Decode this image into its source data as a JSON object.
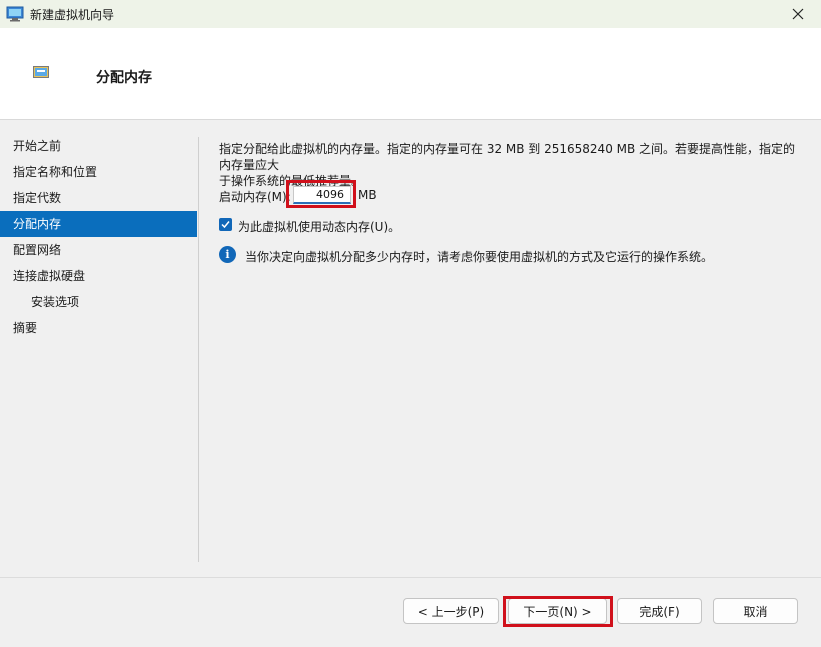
{
  "window": {
    "title": "新建虚拟机向导",
    "close_icon": "close-icon"
  },
  "header": {
    "title": "分配内存",
    "icon": "memory-chip-icon"
  },
  "nav": {
    "items": [
      {
        "label": "开始之前",
        "active": false,
        "sub": false
      },
      {
        "label": "指定名称和位置",
        "active": false,
        "sub": false
      },
      {
        "label": "指定代数",
        "active": false,
        "sub": false
      },
      {
        "label": "分配内存",
        "active": true,
        "sub": false
      },
      {
        "label": "配置网络",
        "active": false,
        "sub": false
      },
      {
        "label": "连接虚拟硬盘",
        "active": false,
        "sub": false
      },
      {
        "label": "安装选项",
        "active": false,
        "sub": true
      },
      {
        "label": "摘要",
        "active": false,
        "sub": false
      }
    ]
  },
  "main": {
    "description_line1": "指定分配给此虚拟机的内存量。指定的内存量可在 32 MB 到 251658240 MB 之间。若要提高性能，指定的内存量应大",
    "description_line2": "于操作系统的最低推荐量。",
    "startup_memory_label": "启动内存(M):",
    "startup_memory_value": "4096",
    "startup_memory_unit": "MB",
    "dynamic_memory_label": "为此虚拟机使用动态内存(U)。",
    "dynamic_memory_checked": true,
    "info_text": "当你决定向虚拟机分配多少内存时，请考虑你要使用虚拟机的方式及它运行的操作系统。"
  },
  "buttons": {
    "prev": "< 上一步(P)",
    "next": "下一页(N) >",
    "finish": "完成(F)",
    "cancel": "取消"
  },
  "colors": {
    "accent": "#0a6ebd",
    "highlight_box": "#d0101b"
  }
}
